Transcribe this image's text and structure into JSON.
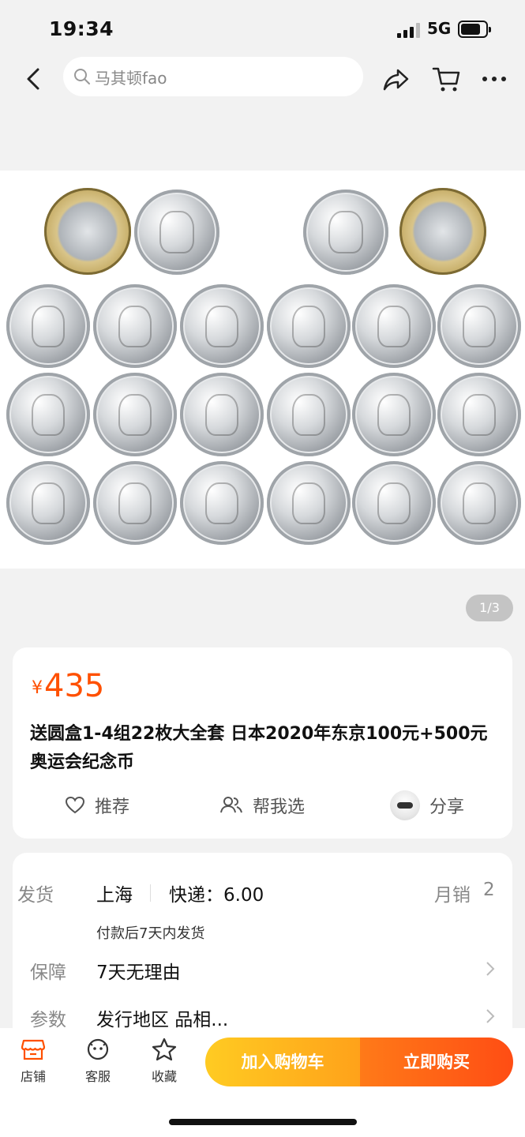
{
  "status_bar": {
    "time": "19:34",
    "network": "5G"
  },
  "nav": {
    "search_query": "马其顿fao"
  },
  "gallery": {
    "pager": "1/3"
  },
  "product": {
    "currency": "¥",
    "price": "435",
    "title": "送圆盒1-4组22枚大全套 日本2020年东京100元+500元奥运会纪念币",
    "actions": {
      "recommend": "推荐",
      "help_choose": "帮我选",
      "share": "分享"
    }
  },
  "shipping": {
    "label": "发货",
    "origin": "上海",
    "express": "快递：6.00",
    "monthly_sales_label": "月销",
    "monthly_sales": "2",
    "delivery_note": "付款后7天内发货"
  },
  "guarantee": {
    "label": "保障",
    "value": "7天无理由"
  },
  "params": {
    "label": "参数",
    "value": "发行地区 品相..."
  },
  "bottom_bar": {
    "store": "店铺",
    "service": "客服",
    "favorite": "收藏",
    "add_to_cart": "加入购物车",
    "buy_now": "立即购买"
  },
  "colors": {
    "accent": "#ff5000",
    "cart_button": "#ffb020",
    "buy_button": "#ff5a16"
  }
}
